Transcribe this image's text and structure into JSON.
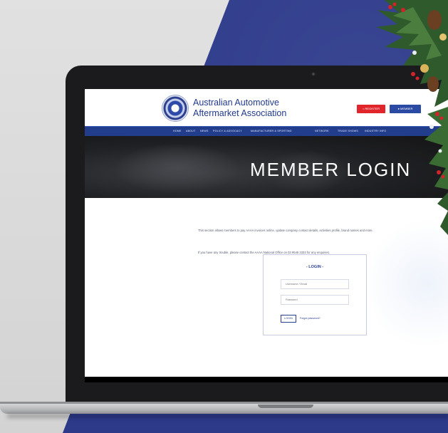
{
  "site": {
    "logo_line1": "Australian Automotive",
    "logo_line2": "Aftermarket Association",
    "register_label": "REGISTER",
    "member_label": "MEMBER",
    "nav": [
      "HOME",
      "ABOUT",
      "NEWS",
      "POLICY & ADVOCACY",
      "MANUFACTURER & SPORTING",
      "NETWORK",
      "TRADE SHOWS",
      "INDUSTRY INFO"
    ]
  },
  "banner": {
    "title": "MEMBER LOGIN"
  },
  "content": {
    "intro": "This section allows members to pay AAAA invoices online, update company contact details, activities profile, brand names and more.",
    "help": "If you have any trouble, please contact the AAAA National Office on 03 9545 3333 for any enquiries."
  },
  "login": {
    "title": "- LOGIN -",
    "username_placeholder": "Username / Email",
    "password_placeholder": "Password",
    "login_button": "LOGIN",
    "forgot_link": "Forgot password?"
  },
  "colors": {
    "navy_bg": "#2d3a8a",
    "brand_blue": "#233a8c",
    "register_red": "#e1262b"
  }
}
